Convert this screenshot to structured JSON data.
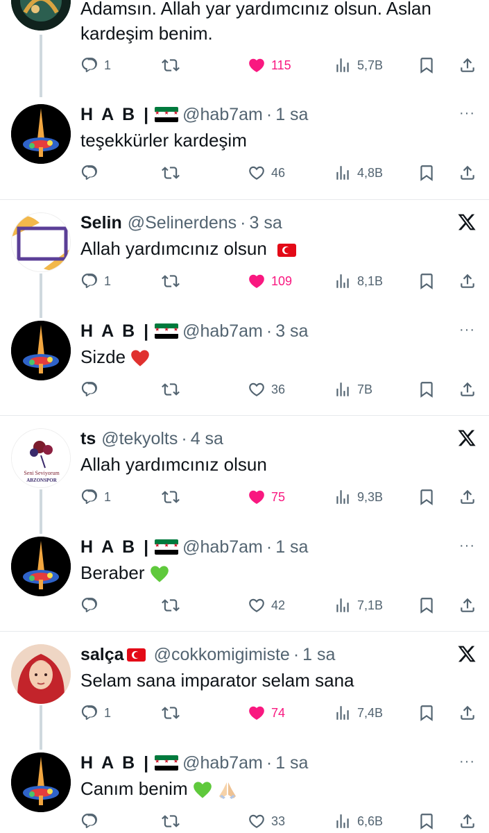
{
  "tweets": [
    {
      "id": "t0",
      "text": "Adamsın. Allah yar yardımcınız olsun. Aslan kardeşim benim.",
      "reply_count": "1",
      "like_count": "115",
      "liked": true,
      "views": "5,7B"
    },
    {
      "id": "t1",
      "name": "H A B |",
      "handle": "@hab7am",
      "time": "1 sa",
      "text": "teşekkürler kardeşim",
      "reply_count": "",
      "like_count": "46",
      "liked": false,
      "views": "4,8B"
    },
    {
      "id": "t2",
      "name": "Selin",
      "handle": "@Selinerdens",
      "time": "3 sa",
      "text": "Allah yardımcınız olsun",
      "reply_count": "1",
      "like_count": "109",
      "liked": true,
      "views": "8,1B"
    },
    {
      "id": "t3",
      "name": "H A B |",
      "handle": "@hab7am",
      "time": "3 sa",
      "text": "Sizde",
      "reply_count": "",
      "like_count": "36",
      "liked": false,
      "views": "7B"
    },
    {
      "id": "t4",
      "name": "ts",
      "handle": "@tekyolts",
      "time": "4 sa",
      "text": "Allah yardımcınız olsun",
      "reply_count": "1",
      "like_count": "75",
      "liked": true,
      "views": "9,3B",
      "avatar_text_1": "Seni Seviyorum",
      "avatar_text_2": "ABZONSPOR"
    },
    {
      "id": "t5",
      "name": "H A B |",
      "handle": "@hab7am",
      "time": "1 sa",
      "text": "Beraber",
      "reply_count": "",
      "like_count": "42",
      "liked": false,
      "views": "7,1B"
    },
    {
      "id": "t6",
      "name": "salça",
      "handle": "@cokkomigimiste",
      "time": "1 sa",
      "text": "Selam sana imparator selam sana",
      "reply_count": "1",
      "like_count": "74",
      "liked": true,
      "views": "7,4B"
    },
    {
      "id": "t7",
      "name": "H A B |",
      "handle": "@hab7am",
      "time": "1 sa",
      "text": "Canım benim",
      "reply_count": "",
      "like_count": "33",
      "liked": false,
      "views": "6,6B"
    }
  ],
  "common": {
    "dot": "·",
    "more_icon": "···"
  },
  "colors": {
    "text": "#0f1419",
    "muted": "#536471",
    "like_active": "#f91880",
    "divider": "#e7e9ec",
    "thread_line": "#cfd9de"
  },
  "icons": [
    "reply-icon",
    "retweet-icon",
    "like-icon",
    "views-icon",
    "bookmark-icon",
    "share-icon",
    "more-icon",
    "x-logo-icon"
  ]
}
